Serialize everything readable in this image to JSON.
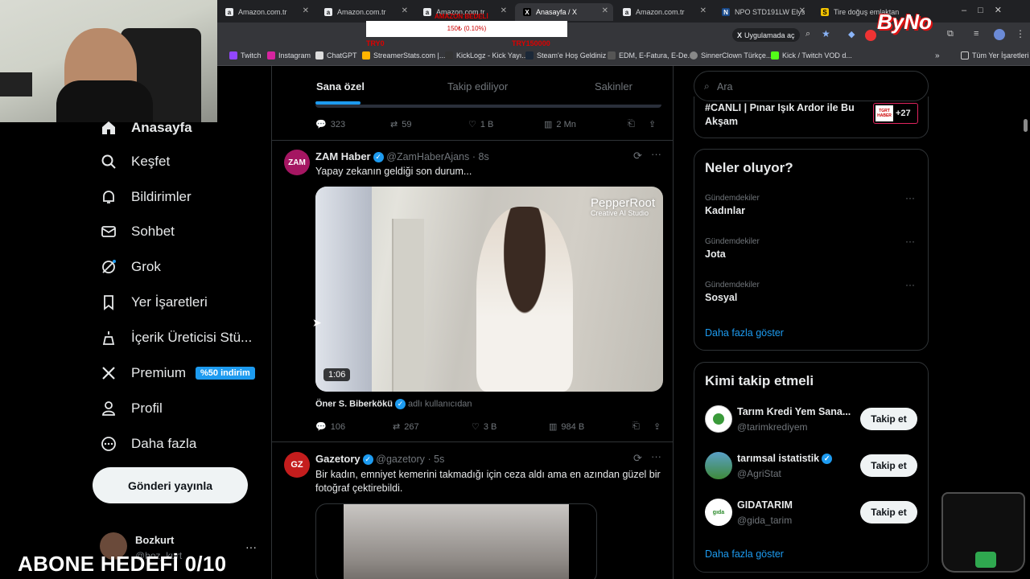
{
  "browser": {
    "tabs": [
      {
        "label": "Amazon.com.tr",
        "icon": "a"
      },
      {
        "label": "Amazon.com.tr",
        "icon": "a"
      },
      {
        "label": "Amazon.com.tr",
        "icon": "a"
      },
      {
        "label": "Anasayfa / X",
        "icon": "X"
      },
      {
        "label": "Amazon.com.tr",
        "icon": "a"
      },
      {
        "label": "NPO STD191LW Elys",
        "icon": "N"
      },
      {
        "label": "Tire doğuş emlaktan",
        "icon": "S"
      }
    ],
    "overlay": {
      "top_text": "AMAZON BEDELİ",
      "bar_text": "150₺ (0.10%)",
      "left_text": "TRY0",
      "right_text": "TRY150000"
    },
    "install_button": "Uygulamada aç",
    "bookmarks": [
      "Twitch",
      "Instagram",
      "ChatGPT",
      "StreamerStats.com |...",
      "KickLogz - Kick Yayı...",
      "Steam'e Hoş Geldiniz",
      "EDM, E-Fatura, E-De...",
      "SinnerClown Türkçe...",
      "Kick / Twitch VOD d..."
    ],
    "all_bookmarks": "Tüm Yer İşaretleri",
    "streamer_logo": "ByNo"
  },
  "nav": {
    "items": [
      {
        "label": "Anasayfa",
        "icon": "home-icon"
      },
      {
        "label": "Keşfet",
        "icon": "search-icon"
      },
      {
        "label": "Bildirimler",
        "icon": "bell-icon"
      },
      {
        "label": "Sohbet",
        "icon": "mail-icon"
      },
      {
        "label": "Grok",
        "icon": "grok-icon"
      },
      {
        "label": "Yer İşaretleri",
        "icon": "bookmark-icon"
      },
      {
        "label": "İçerik Üreticisi Stü...",
        "icon": "creator-icon"
      },
      {
        "label": "Premium",
        "icon": "x-logo-icon"
      },
      {
        "label": "Profil",
        "icon": "person-icon"
      },
      {
        "label": "Daha fazla",
        "icon": "more-circle-icon"
      }
    ],
    "premium_badge": "%50 indirim",
    "post_button": "Gönderi yayınla",
    "account": {
      "name": "Bozkurt",
      "handle": "@boz_kurt"
    }
  },
  "feed": {
    "tabs": [
      "Sana özel",
      "Takip ediliyor",
      "Sakinler"
    ],
    "top_actions": {
      "replies": "323",
      "reposts": "59",
      "likes": "1 B",
      "views": "2 Mn"
    },
    "posts": [
      {
        "avatar": "ZAM",
        "name": "ZAM Haber",
        "handle": "@ZamHaberAjans",
        "time": "· 8s",
        "text": "Yapay zekanın geldiği son durum...",
        "video_watermark": "PepperRoot",
        "video_watermark_sub": "Creative AI Studio",
        "duration": "1:06",
        "attribution_name": "Öner S. Biberkökü",
        "attribution_suffix": "adlı kullanıcıdan",
        "replies": "106",
        "reposts": "267",
        "likes": "3 B",
        "views": "984 B"
      },
      {
        "avatar": "GZ",
        "name": "Gazetory",
        "handle": "@gazetory",
        "time": "· 5s",
        "text": "Bir kadın, emniyet kemerini takmadığı için ceza aldı ama en azından güzel bir fotoğraf çektirebildi."
      }
    ]
  },
  "sidebar": {
    "search_placeholder": "Ara",
    "live": {
      "title": "#CANLI | Pınar Işık Ardor ile Bu Akşam",
      "badge": "TGRT HABER",
      "count": "+27"
    },
    "trends_title": "Neler oluyor?",
    "trends": [
      {
        "category": "Gündemdekiler",
        "name": "Kadınlar"
      },
      {
        "category": "Gündemdekiler",
        "name": "Jota"
      },
      {
        "category": "Gündemdekiler",
        "name": "Sosyal"
      }
    ],
    "show_more": "Daha fazla göster",
    "who_to_follow_title": "Kimi takip etmeli",
    "suggestions": [
      {
        "name": "Tarım Kredi Yem Sana...",
        "handle": "@tarimkrediyem",
        "verified": false
      },
      {
        "name": "tarımsal istatistik",
        "handle": "@AgriStat",
        "verified": true
      },
      {
        "name": "GIDATARIM",
        "handle": "@gida_tarim",
        "verified": false
      }
    ],
    "follow_label": "Takip et",
    "show_more_2": "Daha fazla göster"
  },
  "stream_overlay": {
    "goal": "ABONE HEDEFİ 0/10"
  }
}
